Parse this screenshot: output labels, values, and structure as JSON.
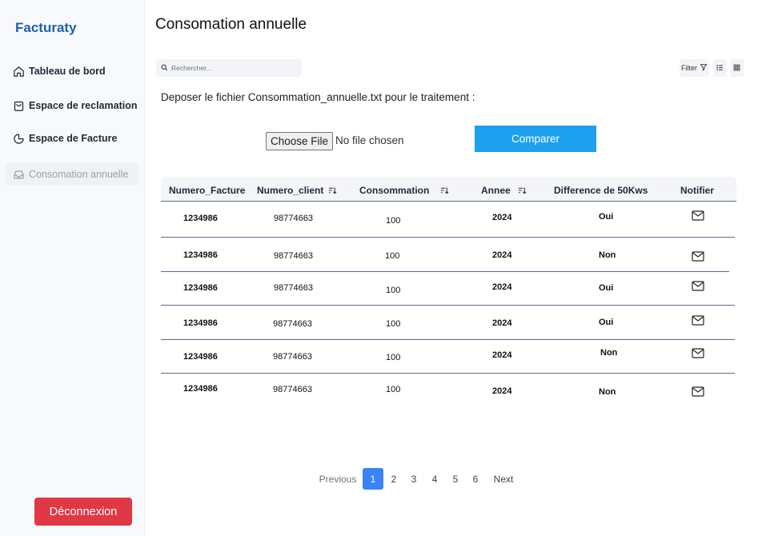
{
  "app": {
    "brand": "Facturaty"
  },
  "sidebar": {
    "items": [
      {
        "label": "Tableau de bord",
        "icon": "home-icon"
      },
      {
        "label": "Espace de reclamation",
        "icon": "shopping-bag-icon"
      },
      {
        "label": "Espace de Facture",
        "icon": "pie-chart-icon"
      },
      {
        "label": "Consomation annuelle",
        "icon": "inbox-icon",
        "active": true
      }
    ],
    "logout_label": "Déconnexion"
  },
  "header": {
    "title": "Consomation annuelle"
  },
  "toolbar": {
    "search_placeholder": "Rechercher...",
    "filter_label": "Filter"
  },
  "upload": {
    "instructions": "Deposer le fichier Consommation_annuelle.txt pour le traitement :",
    "choose_file_label": "Choose File",
    "file_status": "No file chosen",
    "compare_label": "Comparer"
  },
  "table": {
    "headers": [
      "Numero_Facture",
      "Numero_client",
      "Consommation",
      "Annee",
      "Difference de 50Kws",
      "Notifier"
    ],
    "rows": [
      [
        "1234986",
        "98774663",
        "100",
        "2024",
        "Oui"
      ],
      [
        "1234986",
        "98774663",
        "100",
        "2024",
        "Non"
      ],
      [
        "1234986",
        "98774663",
        "100",
        "2024",
        "Oui"
      ],
      [
        "1234986",
        "98774663",
        "100",
        "2024",
        "Oui"
      ],
      [
        "1234986",
        "98774663",
        "100",
        "2024",
        "Non"
      ],
      [
        "1234986",
        "98774663",
        "100",
        "2024",
        "Non"
      ]
    ]
  },
  "pagination": {
    "previous": "Previous",
    "pages": [
      "1",
      "2",
      "3",
      "4",
      "5",
      "6"
    ],
    "current": "1",
    "next": "Next"
  },
  "colors": {
    "brand": "#1f5fa8",
    "compare_button": "#1ea0ef",
    "logout_button": "#e03844",
    "pagination_active": "#3b82f6",
    "table_rule": "#5b6c8a"
  }
}
